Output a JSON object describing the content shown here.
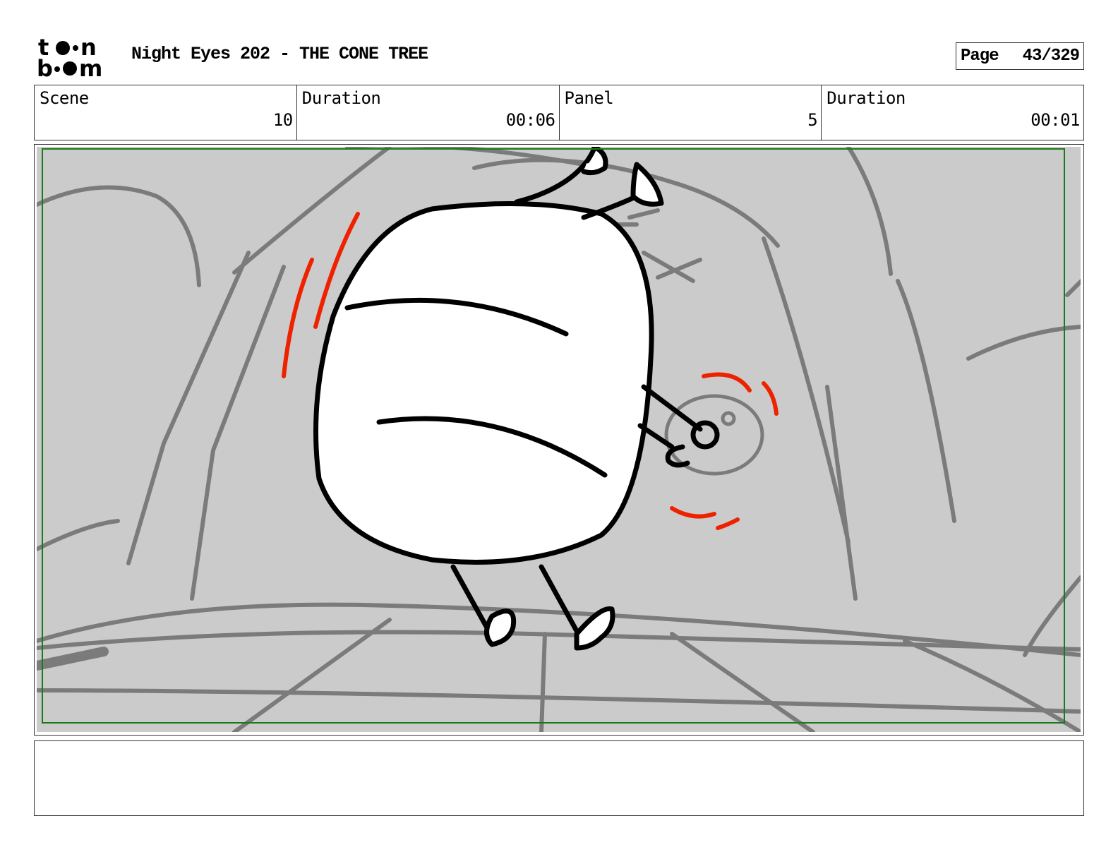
{
  "header": {
    "logo_text": "toon boom",
    "title": "Night Eyes 202 - THE CONE TREE",
    "page_label": "Page",
    "page_value": "43/329"
  },
  "info": {
    "scene_label": "Scene",
    "scene_value": "10",
    "scene_duration_label": "Duration",
    "scene_duration_value": "00:06",
    "panel_label": "Panel",
    "panel_value": "5",
    "panel_duration_label": "Duration",
    "panel_duration_value": "00:01"
  },
  "panel_image": {
    "description_icon": "storyboard-sketch",
    "colors": {
      "background": "#cbcbcb",
      "sketch_lines": "#7b7b7b",
      "ink": "#000000",
      "action_marks": "#ee2200",
      "safe_frame": "#1a7a1a"
    }
  },
  "notes": {
    "text": ""
  }
}
